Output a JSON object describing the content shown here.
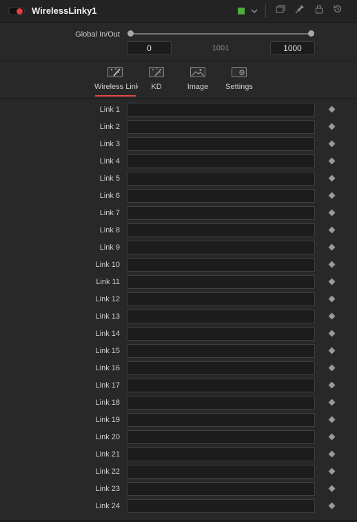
{
  "header": {
    "title": "WirelessLinky1",
    "color_swatch": "#4caf3a",
    "icons": [
      "power-toggle",
      "color-swatch",
      "chevron-down-icon",
      "versions-icon",
      "pin-icon",
      "lock-icon",
      "reset-icon"
    ]
  },
  "global_inout": {
    "label": "Global In/Out",
    "start_value": "0",
    "mid_value": "1001",
    "end_value": "1000"
  },
  "tabs": [
    {
      "label": "Wireless Link",
      "active": true
    },
    {
      "label": "KD",
      "active": false
    },
    {
      "label": "Image",
      "active": false
    },
    {
      "label": "Settings",
      "active": false
    }
  ],
  "links": [
    {
      "label": "Link 1",
      "value": ""
    },
    {
      "label": "Link 2",
      "value": ""
    },
    {
      "label": "Link 3",
      "value": ""
    },
    {
      "label": "Link 4",
      "value": ""
    },
    {
      "label": "Link 5",
      "value": ""
    },
    {
      "label": "Link 6",
      "value": ""
    },
    {
      "label": "Link 7",
      "value": ""
    },
    {
      "label": "Link 8",
      "value": ""
    },
    {
      "label": "Link 9",
      "value": ""
    },
    {
      "label": "Link 10",
      "value": ""
    },
    {
      "label": "Link 11",
      "value": ""
    },
    {
      "label": "Link 12",
      "value": ""
    },
    {
      "label": "Link 13",
      "value": ""
    },
    {
      "label": "Link 14",
      "value": ""
    },
    {
      "label": "Link 15",
      "value": ""
    },
    {
      "label": "Link 16",
      "value": ""
    },
    {
      "label": "Link 17",
      "value": ""
    },
    {
      "label": "Link 18",
      "value": ""
    },
    {
      "label": "Link 19",
      "value": ""
    },
    {
      "label": "Link 20",
      "value": ""
    },
    {
      "label": "Link 21",
      "value": ""
    },
    {
      "label": "Link 22",
      "value": ""
    },
    {
      "label": "Link 23",
      "value": ""
    },
    {
      "label": "Link 24",
      "value": ""
    }
  ]
}
